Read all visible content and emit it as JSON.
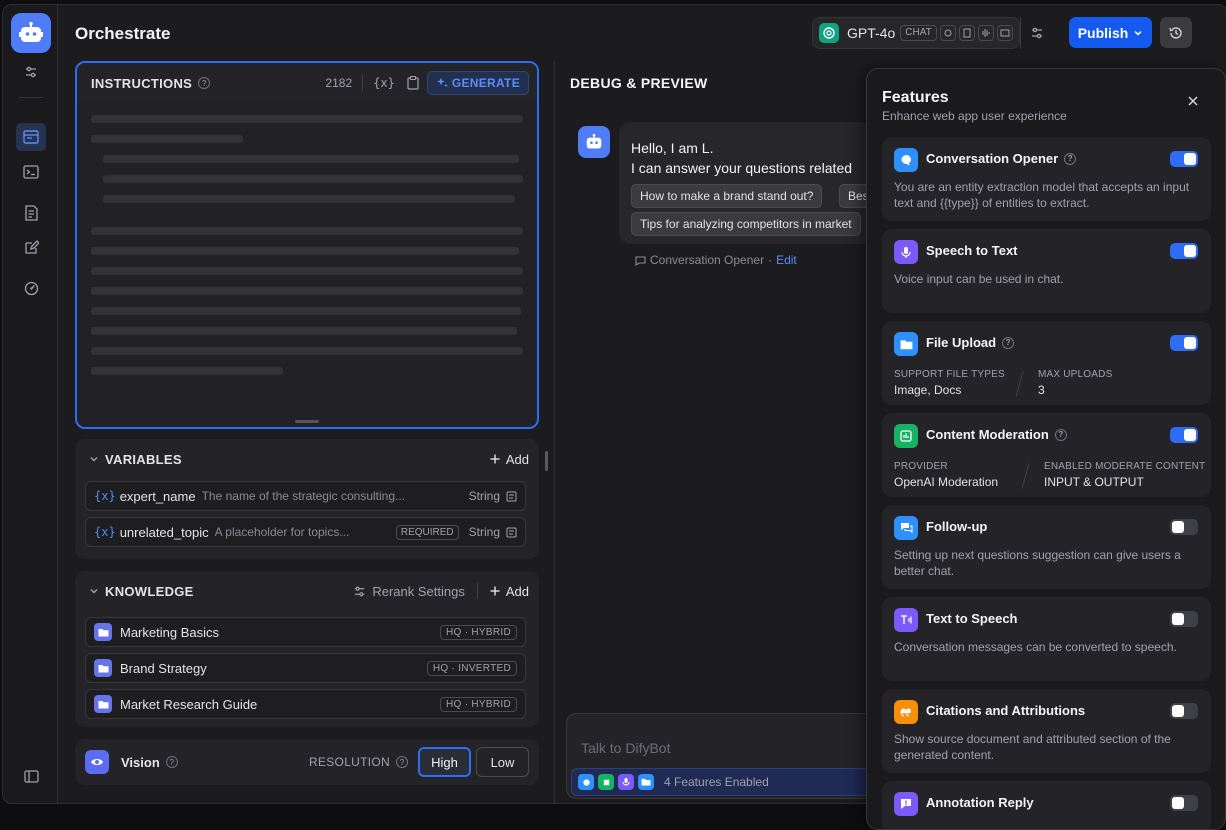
{
  "header": {
    "title": "Orchestrate",
    "model": {
      "name": "GPT-4o",
      "tag": "CHAT"
    },
    "publish_label": "Publish"
  },
  "instructions": {
    "title": "INSTRUCTIONS",
    "char_count": "2182",
    "var_label": "{x}",
    "generate_label": "GENERATE"
  },
  "variables": {
    "title": "VARIABLES",
    "add_label": "Add",
    "items": [
      {
        "prefix": "{x}",
        "name": "expert_name",
        "description": "The name of the strategic consulting...",
        "required": "",
        "type": "String"
      },
      {
        "prefix": "{x}",
        "name": "unrelated_topic",
        "description": "A placeholder for topics...",
        "required": "REQUIRED",
        "type": "String"
      }
    ]
  },
  "knowledge": {
    "title": "KNOWLEDGE",
    "rerank_label": "Rerank Settings",
    "add_label": "Add",
    "items": [
      {
        "name": "Marketing Basics",
        "tag": "HQ · HYBRID"
      },
      {
        "name": "Brand Strategy",
        "tag": "HQ · INVERTED"
      },
      {
        "name": "Market Research Guide",
        "tag": "HQ · HYBRID"
      }
    ]
  },
  "vision": {
    "title": "Vision",
    "resolution_label": "RESOLUTION",
    "options": [
      "High",
      "Low"
    ],
    "selected": "High"
  },
  "debug": {
    "title": "DEBUG & PREVIEW",
    "greeting_line1": "Hello, I am L.",
    "greeting_line2": "I can answer your questions related",
    "suggestions": [
      "How to make a brand stand out?",
      "Bes",
      "Tips for analyzing competitors in market"
    ],
    "opener_ref_label": "Conversation Opener",
    "opener_ref_sep": "·",
    "edit_label": "Edit",
    "input_placeholder": "Talk to DifyBot",
    "features_enabled": "4 Features Enabled"
  },
  "features": {
    "title": "Features",
    "subtitle": "Enhance web app user experience",
    "items": [
      {
        "title": "Conversation Opener",
        "enabled": true,
        "color": "#2e90fa",
        "description": "You are an entity extraction model that accepts an input text and {{type}} of entities to extract."
      },
      {
        "title": "Speech to Text",
        "enabled": true,
        "color": "#7a5af8",
        "description": "Voice input can be used in chat."
      },
      {
        "title": "File Upload",
        "enabled": true,
        "color": "#2e90fa",
        "file_types_label": "SUPPORT FILE TYPES",
        "file_types": "Image, Docs",
        "max_uploads_label": "MAX UPLOADS",
        "max_uploads": "3"
      },
      {
        "title": "Content Moderation",
        "enabled": true,
        "color": "#16b364",
        "provider_label": "PROVIDER",
        "provider": "OpenAI Moderation",
        "content_label": "ENABLED MODERATE CONTENT",
        "content": "INPUT & OUTPUT"
      },
      {
        "title": "Follow-up",
        "enabled": false,
        "color": "#2e90fa",
        "description": "Setting up next questions suggestion can give users a better chat."
      },
      {
        "title": "Text to Speech",
        "enabled": false,
        "color": "#7a5af8",
        "description": "Conversation messages can be converted to speech."
      },
      {
        "title": "Citations and Attributions",
        "enabled": false,
        "color": "#f79009",
        "description": "Show source document and attributed section of the generated content."
      },
      {
        "title": "Annotation Reply",
        "enabled": false,
        "color": "#7a5af8",
        "description": ""
      }
    ]
  }
}
